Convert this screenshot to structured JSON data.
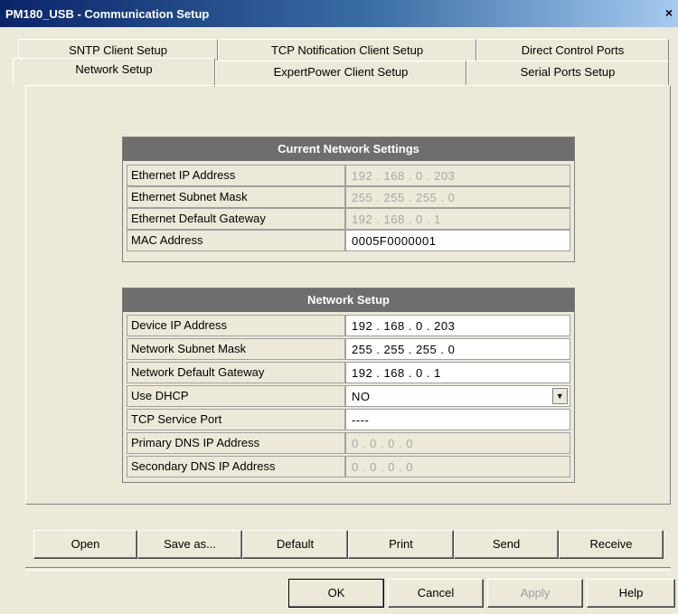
{
  "window": {
    "title": "PM180_USB - Communication Setup",
    "close_glyph": "×"
  },
  "tabs": {
    "row1": [
      "SNTP Client Setup",
      "TCP Notification Client Setup",
      "Direct Control Ports"
    ],
    "row2": [
      "Network Setup",
      "ExpertPower Client Setup",
      "Serial Ports Setup"
    ],
    "active": "Network Setup"
  },
  "current_settings": {
    "header": "Current Network Settings",
    "rows": [
      {
        "label": "Ethernet IP Address",
        "value": "192 . 168 .  0  . 203",
        "disabled": true
      },
      {
        "label": "Ethernet Subnet Mask",
        "value": "255 . 255 . 255 .  0",
        "disabled": true
      },
      {
        "label": "Ethernet Default Gateway",
        "value": "192 . 168 .  0  .  1",
        "disabled": true
      },
      {
        "label": "MAC Address",
        "value": "0005F0000001",
        "disabled": false
      }
    ]
  },
  "network_setup": {
    "header": "Network Setup",
    "rows": [
      {
        "label": "Device IP Address",
        "value": "192 . 168 .  0  . 203",
        "disabled": false
      },
      {
        "label": "Network Subnet Mask",
        "value": "255 . 255 . 255 .  0",
        "disabled": false
      },
      {
        "label": "Network Default Gateway",
        "value": "192 . 168 .  0  .  1",
        "disabled": false
      },
      {
        "label": "Use DHCP",
        "value": "NO",
        "disabled": false
      },
      {
        "label": "TCP Service Port",
        "value": "----",
        "disabled": false
      },
      {
        "label": "Primary DNS IP Address",
        "value": " 0  .  0  .  0  .  0",
        "disabled": true
      },
      {
        "label": "Secondary DNS IP Address",
        "value": " 0  .  0  .  0  .  0",
        "disabled": true
      }
    ]
  },
  "action_buttons": [
    "Open",
    "Save as...",
    "Default",
    "Print",
    "Send",
    "Receive"
  ],
  "dialog_buttons": {
    "ok": "OK",
    "cancel": "Cancel",
    "apply": "Apply",
    "help": "Help"
  }
}
